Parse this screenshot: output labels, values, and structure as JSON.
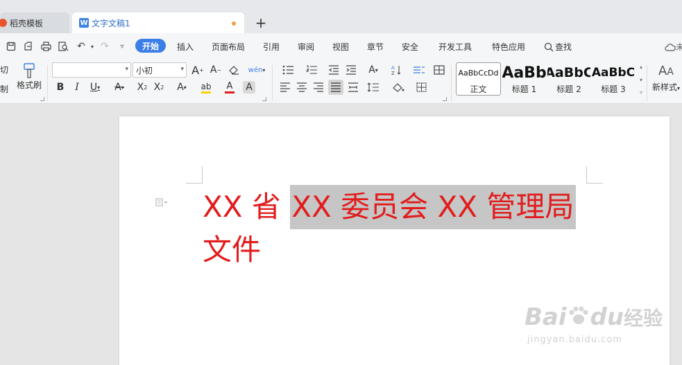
{
  "tabs": [
    {
      "label": "稻壳模板",
      "icon": "docer-icon"
    },
    {
      "label": "文字文稿1",
      "icon": "writer-doc-icon",
      "modified": true
    }
  ],
  "new_tab_symbol": "+",
  "menu": {
    "active": "开始",
    "items": [
      "插入",
      "页面布局",
      "引用",
      "审阅",
      "视图",
      "章节",
      "安全",
      "开发工具",
      "特色应用"
    ],
    "search_label": "查找",
    "cloud_label": "未"
  },
  "clipboard": {
    "cut_label": "切",
    "copy_label": "制",
    "format_painter_label": "格式刷"
  },
  "font": {
    "name_value": "",
    "size_value": "小初"
  },
  "styles": [
    {
      "preview": "AaBbCcDd",
      "label": "正文"
    },
    {
      "preview": "AaBb",
      "label": "标题 1"
    },
    {
      "preview": "AaBbC",
      "label": "标题 2"
    },
    {
      "preview": "AaBbC",
      "label": "标题 3"
    }
  ],
  "new_style_label": "新样式",
  "document": {
    "line1_plain": "XX 省 ",
    "line1_selected": "XX 委员会 XX 管理局",
    "line2": "文件",
    "text_color": "#e21c1c"
  },
  "watermark": {
    "brand": "Bai",
    "brand2": "du",
    "cn": "经验",
    "url": "jingyan.baidu.com"
  },
  "colors": {
    "accent": "#3b7de9",
    "font_color_bar": "#e21c1c",
    "highlight_bar": "#f5d400"
  }
}
